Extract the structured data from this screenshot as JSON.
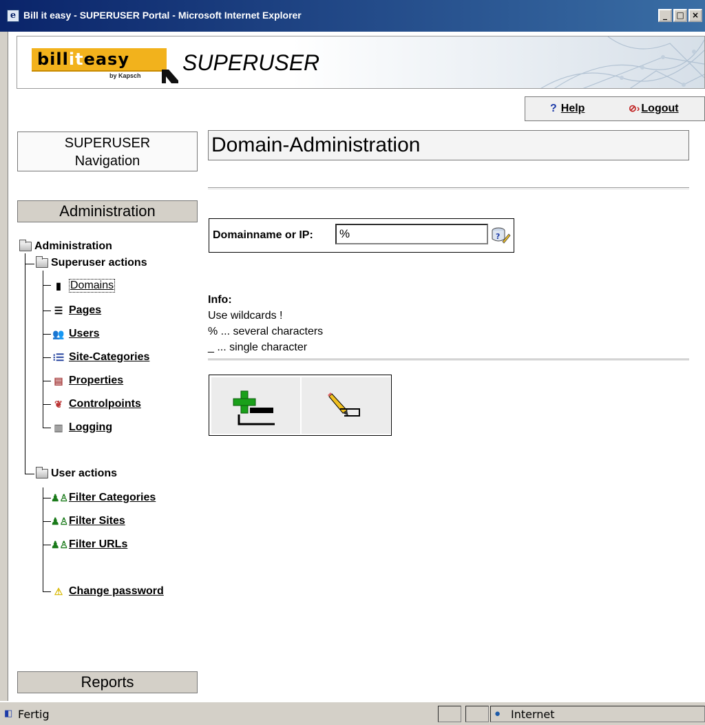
{
  "window": {
    "title": "Bill it easy - SUPERUSER Portal - Microsoft Internet Explorer",
    "minimize_icon": "minimize-icon",
    "maximize_icon": "maximize-icon",
    "close_icon": "close-icon"
  },
  "banner": {
    "logo_bill": "bill",
    "logo_it": "it",
    "logo_easy": "easy",
    "logo_sub": "by Kapsch",
    "title": "SUPERUSER"
  },
  "topbar": {
    "help_label": "Help",
    "logout_label": "Logout"
  },
  "nav": {
    "header_line1": "SUPERUSER",
    "header_line2": "Navigation",
    "section_admin": "Administration",
    "section_reports": "Reports",
    "root": "Administration",
    "superuser_group": "Superuser actions",
    "superuser_items": [
      {
        "label": "Domains",
        "icon": "server-icon"
      },
      {
        "label": "Pages",
        "icon": "page-icon"
      },
      {
        "label": "Users",
        "icon": "users-icon"
      },
      {
        "label": "Site-Categories",
        "icon": "list-icon"
      },
      {
        "label": "Properties",
        "icon": "properties-icon"
      },
      {
        "label": "Controlpoints",
        "icon": "controlpoint-icon"
      },
      {
        "label": "Logging",
        "icon": "logging-icon"
      }
    ],
    "user_group": "User actions",
    "user_items": [
      {
        "label": "Filter Categories",
        "icon": "filter-users-icon"
      },
      {
        "label": "Filter Sites",
        "icon": "filter-users-icon"
      },
      {
        "label": "Filter URLs",
        "icon": "filter-users-icon"
      },
      {
        "label": "Change password",
        "icon": "warning-icon"
      }
    ]
  },
  "main": {
    "page_title": "Domain-Administration",
    "search_label": "Domainname or IP:",
    "search_value": "%",
    "info_title": "Info:",
    "info_lines": [
      "Use wildcards !",
      "% ... several characters",
      "_ ... single character"
    ],
    "add_remove_icon": "add-remove-icon",
    "edit_icon": "edit-pencil-icon"
  },
  "status": {
    "text": "Fertig",
    "zone": "Internet"
  },
  "colors": {
    "titlebar": "#0a246a",
    "logo_orange": "#f2b21c",
    "chrome": "#d4d0c8"
  }
}
